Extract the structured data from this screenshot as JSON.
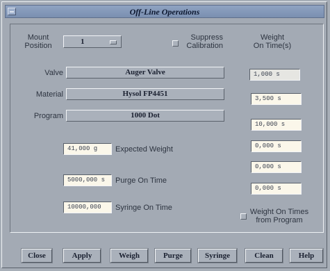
{
  "window": {
    "title": "Off-Line Operations"
  },
  "mount": {
    "label_line1": "Mount",
    "label_line2": "Position",
    "value": "1"
  },
  "suppress": {
    "label_line1": "Suppress",
    "label_line2": "Calibration",
    "checked": false
  },
  "weight_header": {
    "line1": "Weight",
    "line2": "On Time(s)"
  },
  "valve": {
    "label": "Valve",
    "value": "Auger Valve"
  },
  "material": {
    "label": "Material",
    "value": "Hysol FP4451"
  },
  "program": {
    "label": "Program",
    "value": "1000 Dot"
  },
  "expected_weight": {
    "value": "41,000  g",
    "label": "Expected Weight"
  },
  "purge": {
    "value": "5000,000 s",
    "label": "Purge On Time"
  },
  "syringe": {
    "value": "10000,000",
    "label": "Syringe On Time"
  },
  "weight_times": [
    "1,000 s",
    "3,500 s",
    "10,000 s",
    "0,000 s",
    "0,000 s",
    "0,000 s"
  ],
  "weight_from_program": {
    "label_line1": "Weight On Times",
    "label_line2": "from Program",
    "checked": false
  },
  "buttons": {
    "close": "Close",
    "apply": "Apply",
    "weigh": "Weigh",
    "purge": "Purge",
    "syringe": "Syringe",
    "clean": "Clean",
    "help": "Help"
  }
}
